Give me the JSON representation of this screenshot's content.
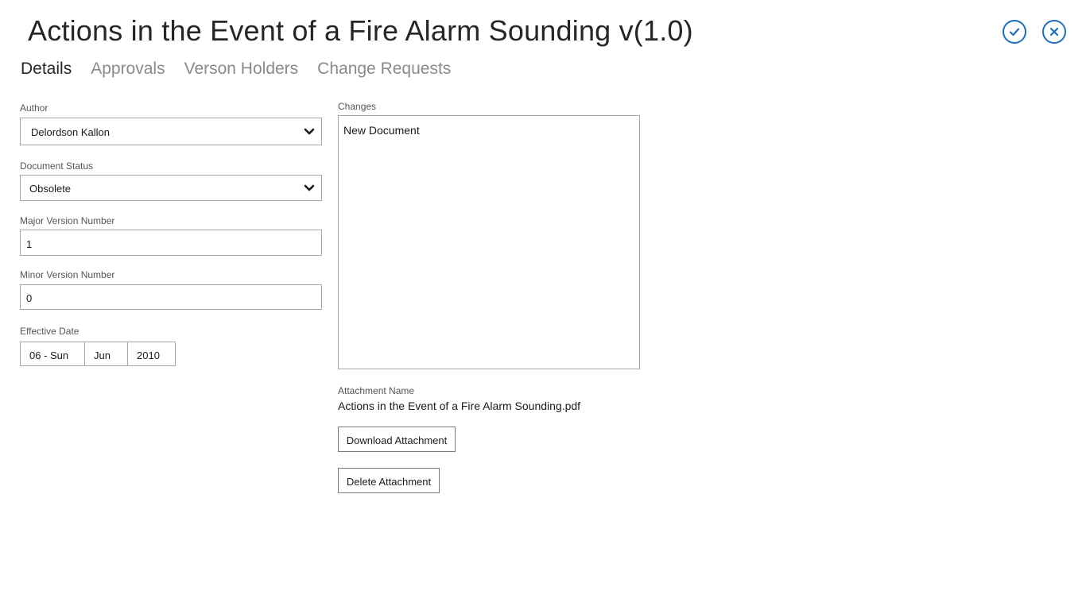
{
  "header": {
    "title": "Actions in the Event of a Fire Alarm Sounding v(1.0)",
    "accent_color": "#1d6fbf",
    "icons": [
      "check-icon",
      "close-icon"
    ]
  },
  "tabs": [
    {
      "label": "Details",
      "active": true
    },
    {
      "label": "Approvals",
      "active": false
    },
    {
      "label": "Verson Holders",
      "active": false
    },
    {
      "label": "Change Requests",
      "active": false
    }
  ],
  "form": {
    "author": {
      "label": "Author",
      "value": "Delordson Kallon"
    },
    "document_status": {
      "label": "Document Status",
      "value": "Obsolete"
    },
    "major_version": {
      "label": "Major Version Number",
      "value": "1"
    },
    "minor_version": {
      "label": "Minor Version Number",
      "value": "0"
    },
    "effective_date": {
      "label": "Effective Date",
      "day": "06 - Sun",
      "month": "Jun",
      "year": "2010"
    }
  },
  "changes": {
    "label": "Changes",
    "value": "New Document"
  },
  "attachment": {
    "label": "Attachment Name",
    "name": "Actions in the Event of a Fire Alarm Sounding.pdf",
    "download_label": "Download Attachment",
    "delete_label": "Delete Attachment"
  }
}
